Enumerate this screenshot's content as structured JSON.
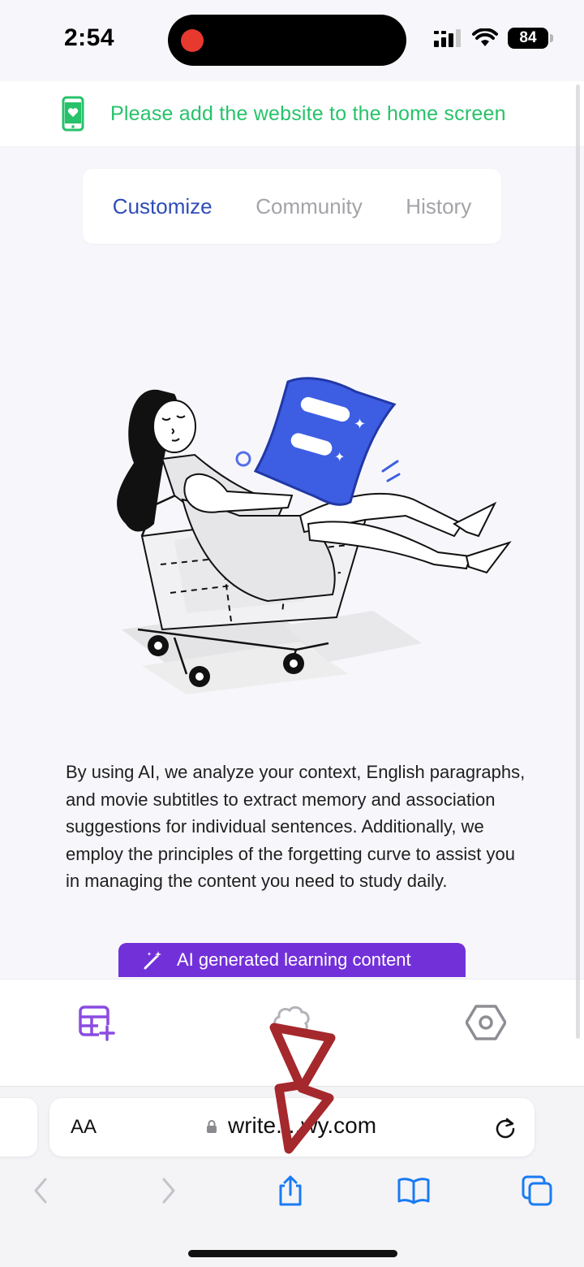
{
  "status_bar": {
    "time": "2:54",
    "battery": "84"
  },
  "banner": {
    "text": "Please add the website to the home screen"
  },
  "tabs": [
    {
      "label": "Customize",
      "active": true
    },
    {
      "label": "Community",
      "active": false
    },
    {
      "label": "History",
      "active": false
    }
  ],
  "description": "By using AI, we analyze your context, English paragraphs, and movie subtitles to extract memory and association suggestions for individual sentences. Additionally, we employ the principles of the forgetting curve to assist you in managing the content you need to study daily.",
  "cta": {
    "label": "AI generated learning content"
  },
  "browser": {
    "text_size_label": "AA",
    "url": "write....wy.com"
  },
  "colors": {
    "accent_blue": "#2f4bb8",
    "banner_green": "#27c26a",
    "cta_purple": "#7230d9",
    "safari_blue": "#1a7bf2",
    "annotation_red": "#a4282c"
  },
  "icons": [
    "add-table-icon",
    "brain-icon",
    "settings-hexagon-icon",
    "back-icon",
    "forward-icon",
    "share-icon",
    "bookmarks-icon",
    "tabs-icon",
    "reload-icon",
    "lock-icon"
  ]
}
